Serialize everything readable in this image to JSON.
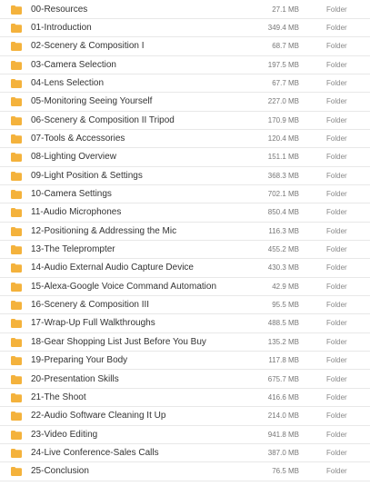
{
  "accent_color": "#f4b23c",
  "folder_icon": "folder-icon",
  "files": [
    {
      "name": "00-Resources",
      "size": "27.1 MB",
      "type": "Folder"
    },
    {
      "name": "01-Introduction",
      "size": "349.4 MB",
      "type": "Folder"
    },
    {
      "name": "02-Scenery & Composition I",
      "size": "68.7 MB",
      "type": "Folder"
    },
    {
      "name": "03-Camera Selection",
      "size": "197.5 MB",
      "type": "Folder"
    },
    {
      "name": "04-Lens Selection",
      "size": "67.7 MB",
      "type": "Folder"
    },
    {
      "name": "05-Monitoring Seeing Yourself",
      "size": "227.0 MB",
      "type": "Folder"
    },
    {
      "name": "06-Scenery & Composition II Tripod",
      "size": "170.9 MB",
      "type": "Folder"
    },
    {
      "name": "07-Tools & Accessories",
      "size": "120.4 MB",
      "type": "Folder"
    },
    {
      "name": "08-Lighting Overview",
      "size": "151.1 MB",
      "type": "Folder"
    },
    {
      "name": "09-Light Position & Settings",
      "size": "368.3 MB",
      "type": "Folder"
    },
    {
      "name": "10-Camera Settings",
      "size": "702.1 MB",
      "type": "Folder"
    },
    {
      "name": "11-Audio Microphones",
      "size": "850.4 MB",
      "type": "Folder"
    },
    {
      "name": "12-Positioning & Addressing the Mic",
      "size": "116.3 MB",
      "type": "Folder"
    },
    {
      "name": "13-The Teleprompter",
      "size": "455.2 MB",
      "type": "Folder"
    },
    {
      "name": "14-Audio External Audio Capture Device",
      "size": "430.3 MB",
      "type": "Folder"
    },
    {
      "name": "15-Alexa-Google Voice Command Automation",
      "size": "42.9 MB",
      "type": "Folder"
    },
    {
      "name": "16-Scenery & Composition III",
      "size": "95.5 MB",
      "type": "Folder"
    },
    {
      "name": "17-Wrap-Up Full Walkthroughs",
      "size": "488.5 MB",
      "type": "Folder"
    },
    {
      "name": "18-Gear Shopping List Just Before You Buy",
      "size": "135.2 MB",
      "type": "Folder"
    },
    {
      "name": "19-Preparing Your Body",
      "size": "117.8 MB",
      "type": "Folder"
    },
    {
      "name": "20-Presentation Skills",
      "size": "675.7 MB",
      "type": "Folder"
    },
    {
      "name": "21-The Shoot",
      "size": "416.6 MB",
      "type": "Folder"
    },
    {
      "name": "22-Audio Software Cleaning It Up",
      "size": "214.0 MB",
      "type": "Folder"
    },
    {
      "name": "23-Video Editing",
      "size": "941.8 MB",
      "type": "Folder"
    },
    {
      "name": "24-Live Conference-Sales Calls",
      "size": "387.0 MB",
      "type": "Folder"
    },
    {
      "name": "25-Conclusion",
      "size": "76.5 MB",
      "type": "Folder"
    }
  ]
}
